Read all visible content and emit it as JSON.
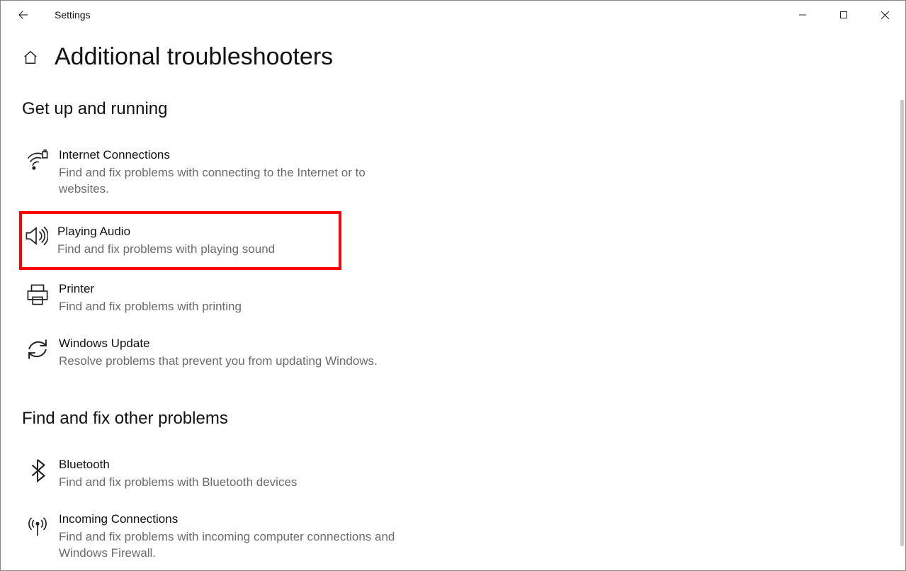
{
  "window": {
    "title": "Settings"
  },
  "page": {
    "title": "Additional troubleshooters"
  },
  "sections": {
    "s1": {
      "title": "Get up and running",
      "items": [
        {
          "title": "Internet Connections",
          "desc": "Find and fix problems with connecting to the Internet or to websites."
        },
        {
          "title": "Playing Audio",
          "desc": "Find and fix problems with playing sound"
        },
        {
          "title": "Printer",
          "desc": "Find and fix problems with printing"
        },
        {
          "title": "Windows Update",
          "desc": "Resolve problems that prevent you from updating Windows."
        }
      ]
    },
    "s2": {
      "title": "Find and fix other problems",
      "items": [
        {
          "title": "Bluetooth",
          "desc": "Find and fix problems with Bluetooth devices"
        },
        {
          "title": "Incoming Connections",
          "desc": "Find and fix problems with incoming computer connections and Windows Firewall."
        }
      ]
    }
  }
}
